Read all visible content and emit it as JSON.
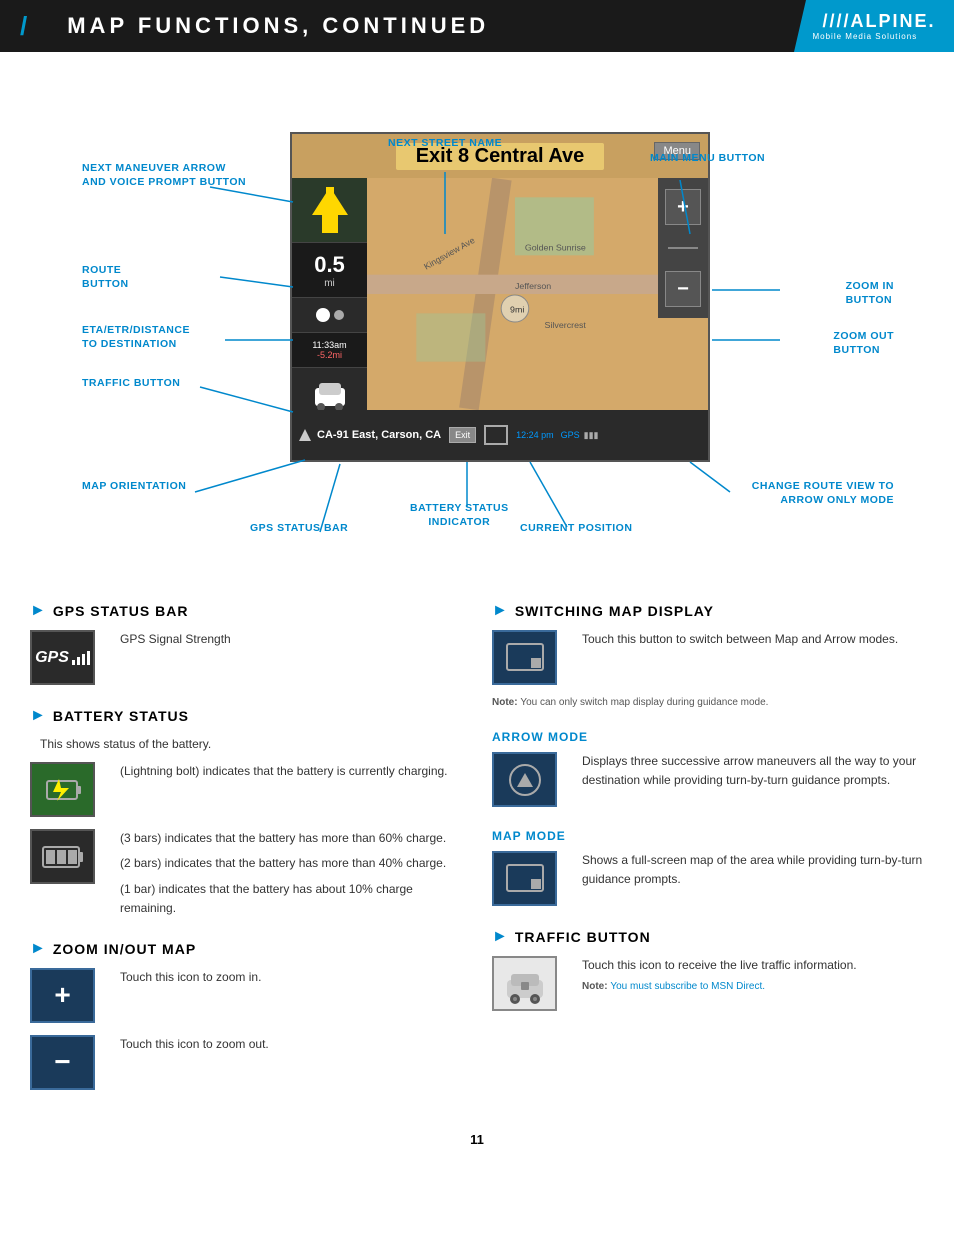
{
  "header": {
    "title": "MAP FUNCTIONS, CONTINUED",
    "slash": "/",
    "brand": "////ALPINE.",
    "brand_sub": "Mobile Media Solutions"
  },
  "diagram": {
    "map_street": "Exit 8 Central Ave",
    "map_menu": "Menu",
    "map_distance": "0.5",
    "map_distance_unit": "mi",
    "map_time": "11:33am",
    "map_dist2": "-5.2mi",
    "map_road": "CA-91 East, Carson, CA",
    "map_time2": "12:24 pm",
    "map_gps": "GPS",
    "labels": {
      "next_maneuver": "NEXT MANEUVER ARROW\nAND VOICE PROMPT BUTTON",
      "next_street": "NEXT STREET NAME",
      "main_menu": "MAIN MENU BUTTON",
      "route_button": "ROUTE\nBUTTON",
      "zoom_in": "ZOOM IN\nBUTTON",
      "zoom_out": "ZOOM OUT\nBUTTON",
      "eta": "ETA/ETR/DISTANCE\nTO DESTINATION",
      "traffic": "TRAFFIC BUTTON",
      "map_orientation": "MAP ORIENTATION",
      "battery_status": "BATTERY STATUS\nINDICATOR",
      "change_route": "CHANGE ROUTE VIEW TO\nARROW ONLY MODE",
      "gps_status": "GPS STATUS BAR",
      "current_position": "CURRENT POSITION"
    }
  },
  "sections": {
    "gps_status_bar": {
      "heading": "GPS STATUS BAR",
      "gps_label": "GPS Signal Strength"
    },
    "battery_status": {
      "heading": "BATTERY STATUS",
      "desc1": "This shows status of the battery.",
      "desc2": "(Lightning bolt) indicates that the battery is currently charging.",
      "desc3": "(3 bars) indicates that the battery has more than 60% charge.",
      "desc4": "(2 bars) indicates that the battery has more than 40% charge.",
      "desc5": "(1 bar) indicates that the battery has about 10% charge remaining."
    },
    "zoom_inout": {
      "heading": "ZOOM IN/OUT MAP",
      "zoom_in_desc": "Touch this icon to zoom in.",
      "zoom_out_desc": "Touch this icon to zoom out."
    },
    "switching_map": {
      "heading": "SWITCHING MAP DISPLAY",
      "desc": "Touch this button to switch between Map and Arrow modes.",
      "note": "You can only switch map display during guidance mode."
    },
    "arrow_mode": {
      "heading": "ARROW MODE",
      "desc": "Displays three successive arrow maneuvers all the way to your destination while providing turn-by-turn guidance prompts."
    },
    "map_mode": {
      "heading": "MAP MODE",
      "desc": "Shows a full-screen map of the area while providing turn-by-turn guidance prompts."
    },
    "traffic_button": {
      "heading": "TRAFFIC BUTTON",
      "desc": "Touch this icon to receive the live traffic information.",
      "note": "You must subscribe to MSN Direct."
    }
  },
  "page_number": "11"
}
